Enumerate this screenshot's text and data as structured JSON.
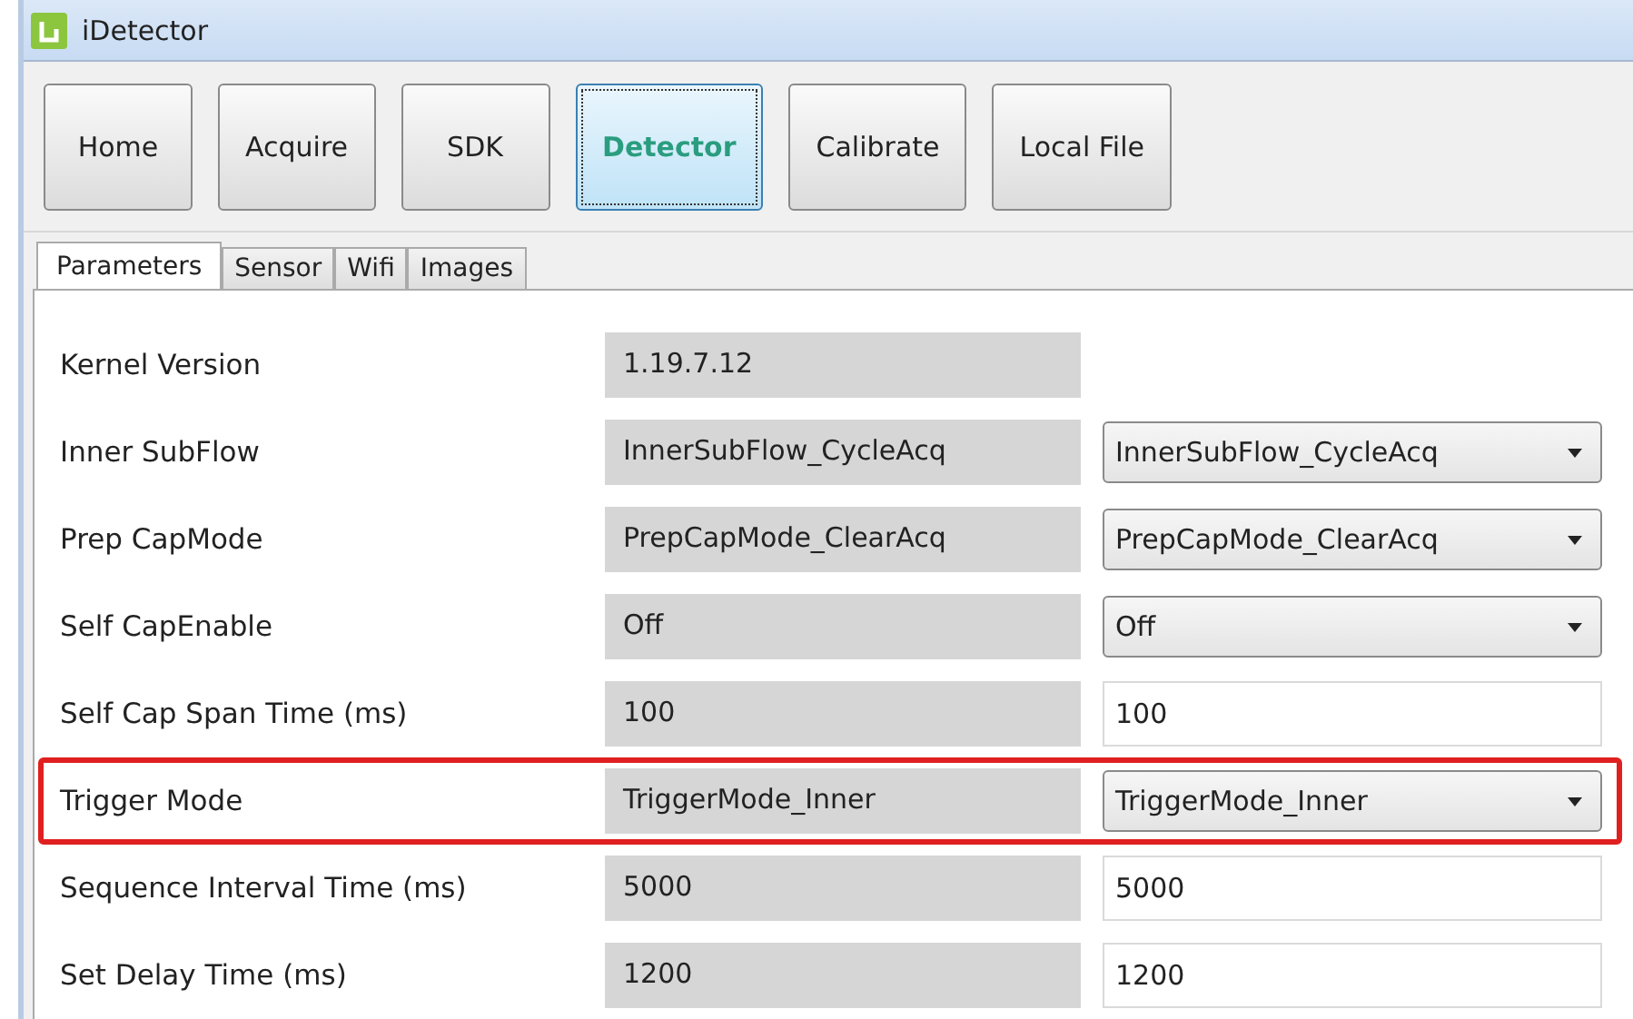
{
  "window": {
    "title": "iDetector"
  },
  "toolbar": [
    {
      "label": "Home",
      "selected": false
    },
    {
      "label": "Acquire",
      "selected": false
    },
    {
      "label": "SDK",
      "selected": false
    },
    {
      "label": "Detector",
      "selected": true
    },
    {
      "label": "Calibrate",
      "selected": false
    },
    {
      "label": "Local File",
      "selected": false
    }
  ],
  "tabs": [
    {
      "label": "Parameters",
      "selected": true
    },
    {
      "label": "Sensor",
      "selected": false
    },
    {
      "label": "Wifi",
      "selected": false
    },
    {
      "label": "Images",
      "selected": false
    }
  ],
  "parameters": [
    {
      "label": "Kernel Version",
      "current": "1.19.7.12",
      "kind": "readonly",
      "highlighted": false
    },
    {
      "label": "Inner SubFlow",
      "current": "InnerSubFlow_CycleAcq",
      "kind": "dropdown",
      "value": "InnerSubFlow_CycleAcq",
      "highlighted": false
    },
    {
      "label": "Prep CapMode",
      "current": "PrepCapMode_ClearAcq",
      "kind": "dropdown",
      "value": "PrepCapMode_ClearAcq",
      "highlighted": false
    },
    {
      "label": "Self CapEnable",
      "current": "Off",
      "kind": "dropdown",
      "value": "Off",
      "highlighted": false
    },
    {
      "label": "Self Cap Span Time (ms)",
      "current": "100",
      "kind": "text",
      "value": "100",
      "highlighted": false
    },
    {
      "label": "Trigger Mode",
      "current": "TriggerMode_Inner",
      "kind": "dropdown",
      "value": "TriggerMode_Inner",
      "highlighted": true
    },
    {
      "label": "Sequence Interval Time (ms)",
      "current": "5000",
      "kind": "text",
      "value": "5000",
      "highlighted": false
    },
    {
      "label": "Set Delay Time (ms)",
      "current": "1200",
      "kind": "text",
      "value": "1200",
      "highlighted": false
    }
  ]
}
